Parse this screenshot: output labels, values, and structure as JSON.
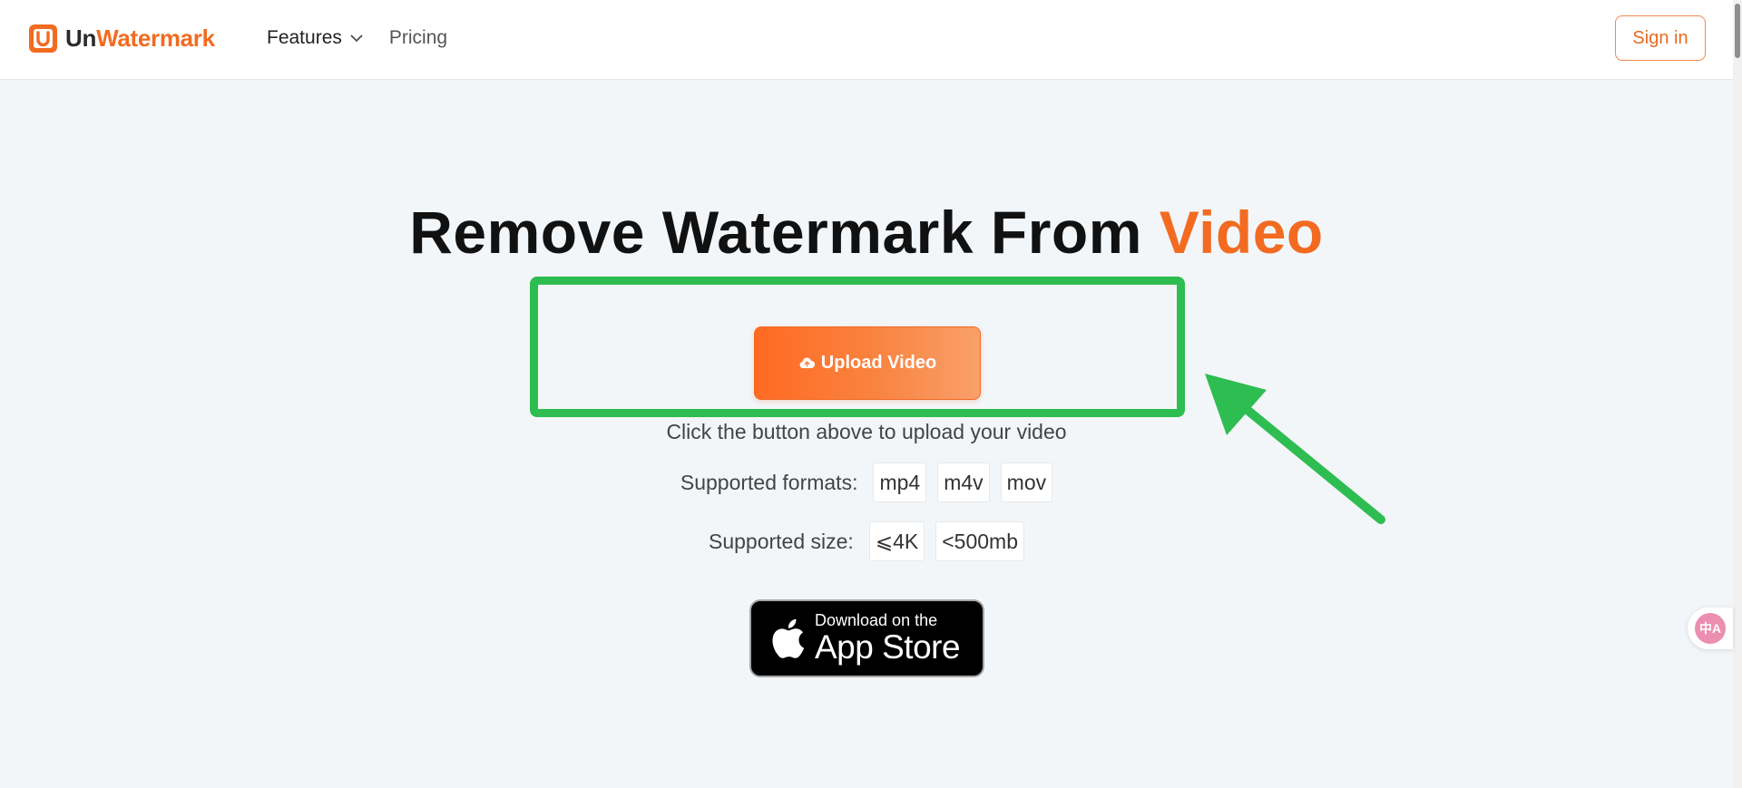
{
  "header": {
    "brand_part1": "Un",
    "brand_part2": "Watermark",
    "nav": {
      "features": "Features",
      "pricing": "Pricing"
    },
    "signin": "Sign in"
  },
  "hero": {
    "title_main": "Remove Watermark From ",
    "title_highlight": "Video",
    "upload_button": "Upload Video",
    "hint": "Click the button above to upload your video",
    "formats_label": "Supported formats:",
    "formats": [
      "mp4",
      "m4v",
      "mov"
    ],
    "size_label": "Supported size:",
    "sizes": [
      "⩽4K",
      "<500mb"
    ],
    "appstore": {
      "small": "Download on the",
      "big": "App Store"
    }
  },
  "float_widget": {
    "icon_text": "中A"
  },
  "colors": {
    "accent": "#f26b21",
    "highlight_box": "#2ebd50",
    "background": "#f3f6f9"
  },
  "icons": [
    "logo-mark-icon",
    "chevron-down-icon",
    "cloud-upload-icon",
    "apple-icon",
    "arrow-annotation",
    "translate-icon"
  ]
}
